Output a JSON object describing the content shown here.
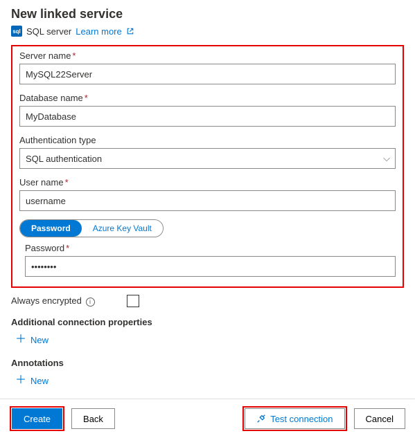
{
  "header": {
    "title": "New linked service",
    "service_type": "SQL server",
    "learn_more": "Learn more"
  },
  "form": {
    "server_name": {
      "label": "Server name",
      "value": "MySQL22Server"
    },
    "database_name": {
      "label": "Database name",
      "value": "MyDatabase"
    },
    "auth_type": {
      "label": "Authentication type",
      "value": "SQL authentication"
    },
    "user_name": {
      "label": "User name",
      "value": "username"
    },
    "pw_toggle": {
      "opt1": "Password",
      "opt2": "Azure Key Vault"
    },
    "password": {
      "label": "Password",
      "value": "••••••••"
    }
  },
  "extras": {
    "always_encrypted": "Always encrypted",
    "additional_props": "Additional connection properties",
    "annotations": "Annotations",
    "new_label": "New"
  },
  "footer": {
    "create": "Create",
    "back": "Back",
    "test": "Test connection",
    "cancel": "Cancel"
  }
}
